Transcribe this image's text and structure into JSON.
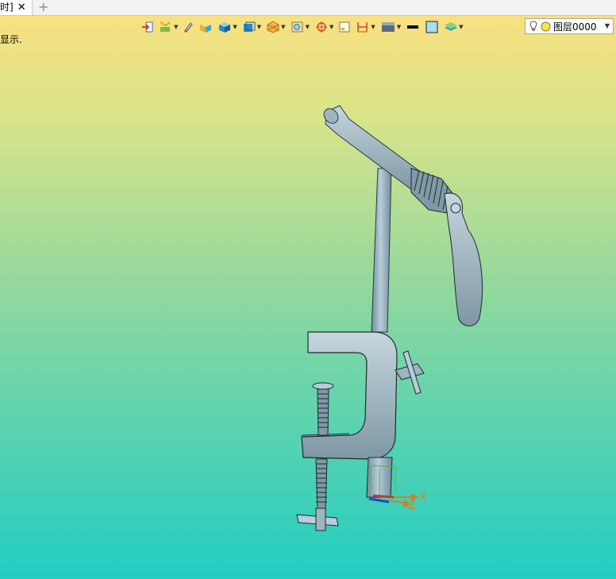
{
  "tab": {
    "title": "时]",
    "close_glyph": "✕",
    "add_glyph": "+"
  },
  "hint_text": "显示.",
  "layer": {
    "label": "图层0000"
  },
  "axes": {
    "x_label": "X",
    "z_label": "Z"
  },
  "toolbar_icons": [
    "import-icon",
    "select-filter-icon",
    "pencil-icon",
    "box-yellow-icon",
    "box-blue-icon",
    "view-orient-icon",
    "render-mode-icon",
    "zoom-fit-icon",
    "snap-icon",
    "frame-icon",
    "dimension-icon",
    "display-style-icon",
    "line-color-icon",
    "fill-color-icon",
    "layer-stack-icon"
  ]
}
